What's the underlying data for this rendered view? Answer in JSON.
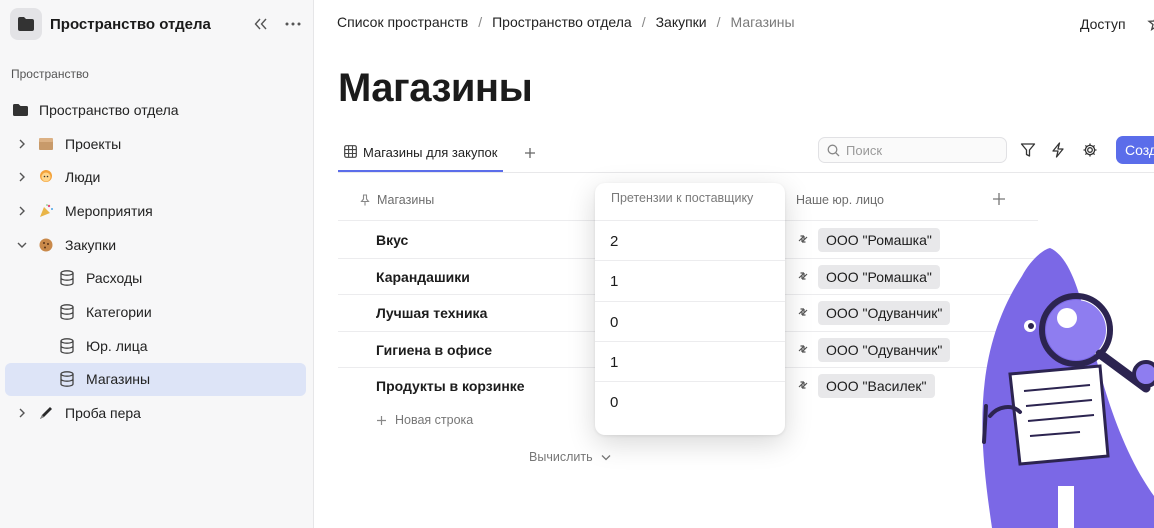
{
  "sidebar": {
    "workspace_title": "Пространство отдела",
    "collapse_icon": "double-chevron-left-icon",
    "more_icon": "ellipsis-icon",
    "section_label": "Пространство",
    "items": [
      {
        "label": "Пространство отдела",
        "icon": "folder-icon",
        "level": 0
      },
      {
        "label": "Проекты",
        "icon": "box-emoji",
        "level": 1,
        "expanded": false
      },
      {
        "label": "Люди",
        "icon": "person-emoji",
        "level": 1,
        "expanded": false
      },
      {
        "label": "Мероприятия",
        "icon": "party-popper-emoji",
        "level": 1,
        "expanded": false
      },
      {
        "label": "Закупки",
        "icon": "cookie-emoji",
        "level": 1,
        "expanded": true
      },
      {
        "label": "Расходы",
        "icon": "database-icon",
        "level": 2
      },
      {
        "label": "Категории",
        "icon": "database-icon",
        "level": 2
      },
      {
        "label": "Юр. лица",
        "icon": "database-icon",
        "level": 2
      },
      {
        "label": "Магазины",
        "icon": "database-icon",
        "level": 2,
        "active": true
      },
      {
        "label": "Проба пера",
        "icon": "pen-emoji",
        "level": 1,
        "expanded": false
      }
    ]
  },
  "header": {
    "breadcrumb": [
      "Список пространств",
      "Пространство отдела",
      "Закупки",
      "Магазины"
    ],
    "access_label": "Доступ"
  },
  "page": {
    "title": "Магазины"
  },
  "toolbar": {
    "tab_label": "Магазины для закупок",
    "search_placeholder": "Поиск",
    "create_label": "Созд"
  },
  "table": {
    "columns": [
      "Магазины",
      "Претензии к поставщику",
      "Наше юр. лицо"
    ],
    "rows": [
      {
        "name": "Вкус",
        "claims": "2",
        "legal_entity": "ООО \"Ромашка\""
      },
      {
        "name": "Карандашики",
        "claims": "1",
        "legal_entity": "ООО \"Ромашка\""
      },
      {
        "name": "Лучшая техника",
        "claims": "0",
        "legal_entity": "ООО \"Одуванчик\""
      },
      {
        "name": "Гигиена в офисе",
        "claims": "1",
        "legal_entity": "ООО \"Одуванчик\""
      },
      {
        "name": "Продукты в корзинке",
        "claims": "0",
        "legal_entity": "ООО \"Василек\""
      }
    ],
    "new_row_label": "Новая строка",
    "calculate_label": "Вычислить"
  },
  "colors": {
    "accent": "#5b6dea",
    "active_item_bg": "#dde4f7",
    "illustration": "#7b68e6"
  }
}
